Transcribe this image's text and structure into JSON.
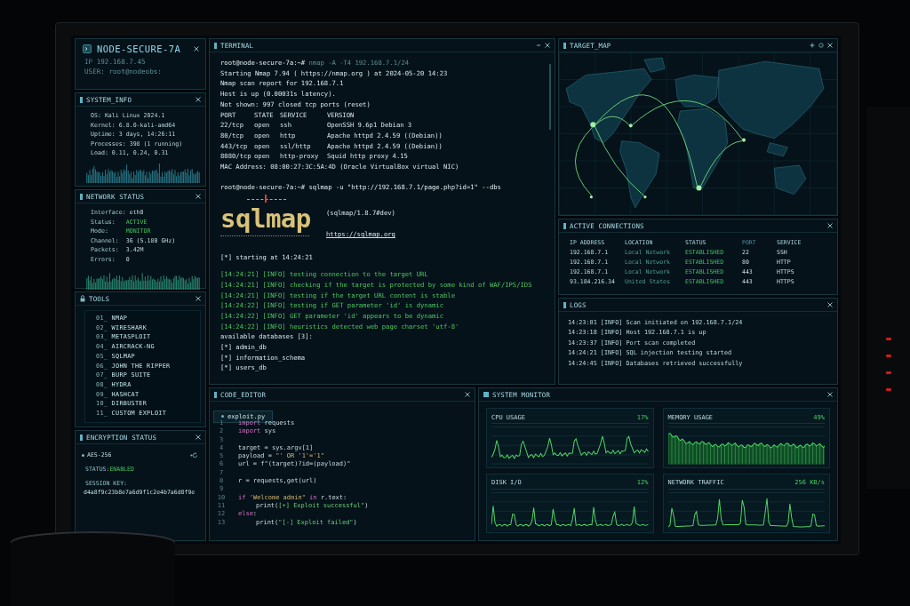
{
  "node": {
    "title": "NODE-SECURE-7A",
    "ip": "IP 192.168.7.45",
    "user": "USER: root@nodeobs:"
  },
  "system_info": {
    "title": "SYSTEM_INFO",
    "lines": [
      "OS: Kali Linux 2024.1",
      "Kernel: 6.8.0-kali-amd64",
      "Uptime: 3 days, 14:26:11",
      "Processes: 398 (1 running)",
      "Load: 0.11, 0.24, 0.31"
    ]
  },
  "network_status": {
    "title": "NETWORK STATUS",
    "rows": [
      {
        "label": "Interface:",
        "value": "eth0",
        "highlighted": false
      },
      {
        "label": "Status:",
        "value": "ACTIVE",
        "highlighted": true
      },
      {
        "label": "Mode:",
        "value": "MONITOR",
        "highlighted": true
      },
      {
        "label": "Channel:",
        "value": "36 (5.180 GHz)",
        "highlighted": false
      },
      {
        "label": "Packets:",
        "value": "3.42M",
        "highlighted": false
      },
      {
        "label": "Errors:",
        "value": "0",
        "highlighted": false
      }
    ]
  },
  "tools": {
    "title": "TOOLS",
    "items": [
      {
        "number": "01_",
        "name": "NMAP"
      },
      {
        "number": "02_",
        "name": "WIRESHARK"
      },
      {
        "number": "03_",
        "name": "METASPLOIT"
      },
      {
        "number": "04_",
        "name": "AIRCRACK-NG"
      },
      {
        "number": "05_",
        "name": "SQLMAP"
      },
      {
        "number": "06_",
        "name": "JOHN THE RIPPER"
      },
      {
        "number": "07_",
        "name": "BURP SUITE"
      },
      {
        "number": "08_",
        "name": "HYDRA"
      },
      {
        "number": "09_",
        "name": "HASHCAT"
      },
      {
        "number": "10_",
        "name": "DIRBUSTER"
      },
      {
        "number": "11_",
        "name": "CUSTOM EXPLOIT"
      }
    ]
  },
  "encryption": {
    "title": "ENCRYPTION STATUS",
    "cipher": "AES-256",
    "status_label": "STATUS:",
    "status_value": "ENABLED",
    "key_label": "SESSION KEY:",
    "key": "d4a8f9c23b8e7a6d9f1c2e4b7a6d8f9e"
  },
  "terminal": {
    "title": "TERMINAL",
    "lines": [
      {
        "kind": "prompt",
        "prompt": "root@node-secure-7a:~#",
        "command": "nmap -A -T4 192.168.7.1/24",
        "dimmed": true
      },
      {
        "kind": "text",
        "text": "Starting Nmap 7.94 ( https://nmap.org ) at 2024-05-20 14:23"
      },
      {
        "kind": "text",
        "text": "Nmap scan report for 192.168.7.1"
      },
      {
        "kind": "text",
        "text": "Host is up (0.00031s latency)."
      },
      {
        "kind": "text",
        "text": "Not shown: 997 closed tcp ports (reset)"
      },
      {
        "kind": "columns",
        "cells": [
          "PORT",
          "STATE",
          "SERVICE",
          "VERSION"
        ]
      },
      {
        "kind": "columns",
        "cells": [
          "22/tcp",
          "open",
          "ssh",
          "OpenSSH 9.6p1 Debian 3"
        ]
      },
      {
        "kind": "columns",
        "cells": [
          "80/tcp",
          "open",
          "http",
          "Apache httpd 2.4.59 ((Debian))"
        ]
      },
      {
        "kind": "columns",
        "cells": [
          "443/tcp",
          "open",
          "ssl/http",
          "Apache httpd 2.4.59 ((Debian))"
        ]
      },
      {
        "kind": "columns",
        "cells": [
          "8080/tcp",
          "open",
          "http-proxy",
          "Squid http proxy 4.15"
        ]
      },
      {
        "kind": "text",
        "text": "MAC Address: 08:00:27:3C:5A:4D (Oracle VirtualBox virtual NIC)"
      },
      {
        "kind": "prompt",
        "prompt": "root@node-secure-7a:~#",
        "command": "sqlmap -u \"http://192.168.7.1/page.php?id=1\" --dbs",
        "dimmed": false
      },
      {
        "kind": "banner",
        "logo": "sqlmap",
        "version": "(sqlmap/1.8.7#dev)",
        "url": "https://sqlmap.org"
      },
      {
        "kind": "text",
        "text": "[*] starting at 14:24:21"
      },
      {
        "kind": "info",
        "text": "[14:24:21] [INFO] testing connection to the target URL"
      },
      {
        "kind": "info",
        "text": "[14:24:21] [INFO] checking if the target is protected by some kind of WAF/IPS/IDS"
      },
      {
        "kind": "info",
        "text": "[14:24:21] [INFO] testing if the target URL content is stable"
      },
      {
        "kind": "info",
        "text": "[14:24:22] [INFO] testing if GET parameter 'id' is dynamic"
      },
      {
        "kind": "info",
        "text": "[14:24:22] [INFO] GET parameter 'id' appears to be dynamic"
      },
      {
        "kind": "info",
        "text": "[14:24:22] [INFO] heuristics detected web page charset 'utf-8'"
      },
      {
        "kind": "text",
        "text": "available databases [3]:"
      },
      {
        "kind": "text",
        "text": "[*] admin_db"
      },
      {
        "kind": "text",
        "text": "[*] information_schema"
      },
      {
        "kind": "text",
        "text": "[*] users_db"
      }
    ]
  },
  "code_editor": {
    "title": "CODE_EDITOR",
    "tabs": [
      {
        "label": "exploit.py",
        "selected": true
      }
    ],
    "lines": [
      {
        "number": "1",
        "tokens": [
          {
            "kind": "keyword",
            "text": "import"
          },
          {
            "kind": "text",
            "text": " requests"
          }
        ]
      },
      {
        "number": "2",
        "tokens": [
          {
            "kind": "keyword",
            "text": "import"
          },
          {
            "kind": "text",
            "text": " sys"
          }
        ]
      },
      {
        "number": "3"
      },
      {
        "number": "4",
        "tokens": [
          {
            "kind": "text",
            "text": "target = sys.argv[1]"
          }
        ]
      },
      {
        "number": "5",
        "tokens": [
          {
            "kind": "text",
            "text": "payload = "
          },
          {
            "kind": "string",
            "text": "\"' OR '1'='1\""
          }
        ]
      },
      {
        "number": "6",
        "tokens": [
          {
            "kind": "text",
            "text": "url = f\"(target)?id=(payload)\""
          }
        ]
      },
      {
        "number": "7"
      },
      {
        "number": "8",
        "tokens": [
          {
            "kind": "text",
            "text": "r = requests,get(url)"
          }
        ]
      },
      {
        "number": "9"
      },
      {
        "number": "10",
        "tokens": [
          {
            "kind": "keyword",
            "text": "if"
          },
          {
            "kind": "string",
            "text": " 'Welcome admin\""
          },
          {
            "kind": "keyword",
            "text": " in"
          },
          {
            "kind": "text",
            "text": " r.text:"
          }
        ],
        "children": [
          {
            "number": "11",
            "tokens": [
              {
                "kind": "text",
                "text": "print("
              },
              {
                "kind": "message",
                "text": "[+] Exploit successful\""
              },
              {
                "kind": "text",
                "text": ")"
              }
            ]
          }
        ]
      },
      {
        "number": "12",
        "tokens": [
          {
            "kind": "keyword",
            "text": "else"
          },
          {
            "kind": "text",
            "text": ":"
          }
        ],
        "children": [
          {
            "number": "13",
            "tokens": [
              {
                "kind": "text",
                "text": "print("
              },
              {
                "kind": "message",
                "text": "\"[-] Exploit failed\""
              },
              {
                "kind": "text",
                "text": ")"
              }
            ]
          }
        ]
      }
    ]
  },
  "system_monitor": {
    "title": "SYSTEM MONITOR",
    "cards": [
      {
        "title": "CPU USAGE",
        "value": "17%",
        "kind": "line"
      },
      {
        "title": "MEMORY USAGE",
        "value": "49%",
        "kind": "area"
      },
      {
        "title": "DISK I/O",
        "value": "12%",
        "kind": "line"
      },
      {
        "title": "NETWORK TRAFFIC",
        "value": "256 KB/s",
        "kind": "line"
      }
    ]
  },
  "target_map": {
    "title": "TARGET_MAP"
  },
  "connections": {
    "title": "ACTIVE CONNECTIONS",
    "columns": [
      "IP ADDRESS",
      "LOCATION",
      "STATUS",
      "PORT",
      "SERVICE"
    ],
    "rows": [
      [
        "192.168.7.1",
        "Local Network",
        "ESTABLISHED",
        "22",
        "SSH"
      ],
      [
        "192.168.7.1",
        "Local Network",
        "ESTABLISHED",
        "80",
        "HTTP"
      ],
      [
        "192.168.7.1",
        "Local Network",
        "ESTABLISHED",
        "443",
        "HTTPS"
      ],
      [
        "93.184.216.34",
        "United States",
        "ESTABLISHED",
        "443",
        "HTTPS"
      ]
    ]
  },
  "logs": {
    "title": "LOGS",
    "entries": [
      "14:23:01 [INFO] Scan initiated on 192.168.7.1/24",
      "14:23:18 [INFO] Host 192.168.7.1 is up",
      "14:23:37 [INFO] Port scan completed",
      "14:24:21 [INFO] SQL injection testing started",
      "14:24:45 [INFO] Databases retrieved successfully"
    ]
  }
}
